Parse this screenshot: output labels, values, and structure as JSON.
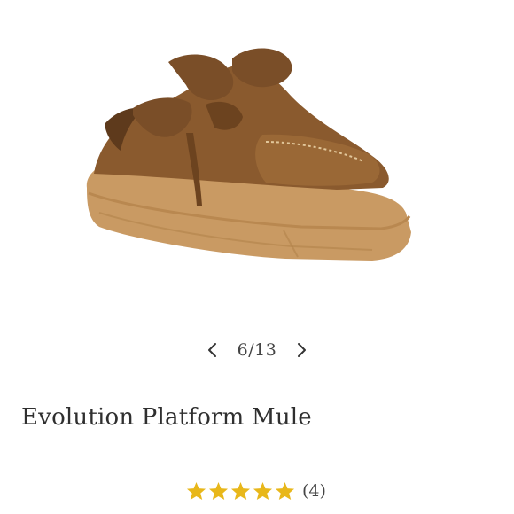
{
  "gallery": {
    "current": "6",
    "total": "13",
    "counter_text": "6/13"
  },
  "product": {
    "title": "Evolution Platform Mule"
  },
  "rating": {
    "stars": 5,
    "max_stars": 5,
    "review_count_text": "(4)",
    "star_color": "#E8B71A"
  },
  "icons": {
    "prev": "chevron-left-icon",
    "next": "chevron-right-icon",
    "star": "star-icon"
  }
}
